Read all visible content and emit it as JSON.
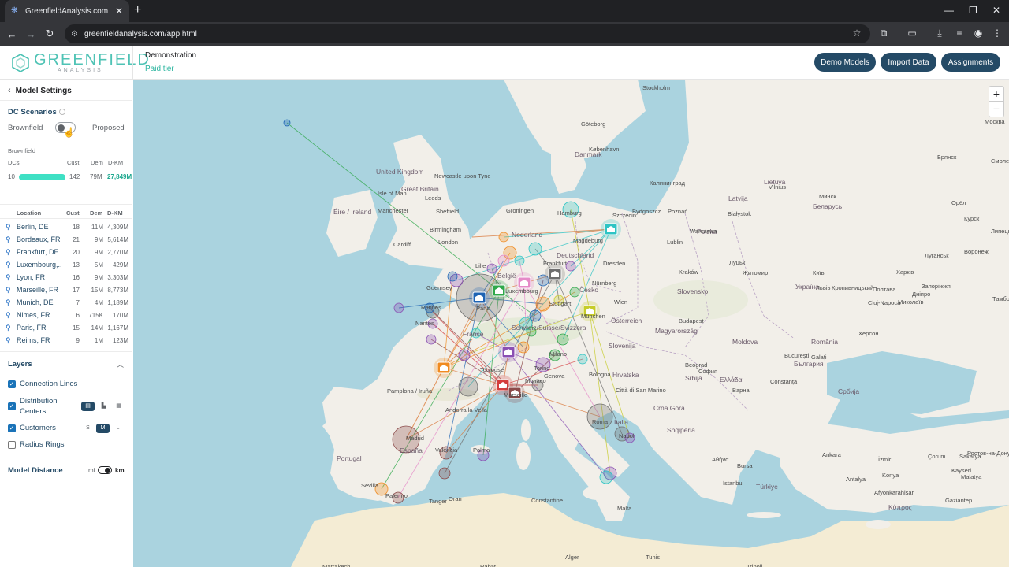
{
  "browser": {
    "tab_title": "GreenfieldAnalysis.com",
    "url": "greenfieldanalysis.com/app.html"
  },
  "header": {
    "logo_main": "GREENFIELD",
    "logo_sub": "ANALYSIS",
    "account_name": "Demonstration",
    "account_tier": "Paid tier",
    "buttons": [
      "Demo Models",
      "Import Data",
      "Assignments"
    ]
  },
  "sidebar": {
    "back_label": "Model Settings",
    "scenarios_title": "DC Scenarios",
    "scenario_left": "Brownfield",
    "scenario_right": "Proposed",
    "summary": {
      "heading": "Brownfield",
      "col_dcs": "DCs",
      "col_cust": "Cust",
      "col_dem": "Dem",
      "col_dkm": "D-KM",
      "dcs": "10",
      "cust": "142",
      "dem": "79M",
      "dkm": "27,849M"
    },
    "table": {
      "headers": [
        "Location",
        "Cust",
        "Dem",
        "D-KM"
      ],
      "rows": [
        {
          "loc": "Berlin, DE",
          "cust": "18",
          "dem": "11M",
          "dkm": "4,309M"
        },
        {
          "loc": "Bordeaux, FR",
          "cust": "21",
          "dem": "9M",
          "dkm": "5,614M"
        },
        {
          "loc": "Frankfurt, DE",
          "cust": "20",
          "dem": "9M",
          "dkm": "2,770M"
        },
        {
          "loc": "Luxembourg,...",
          "cust": "13",
          "dem": "5M",
          "dkm": "429M"
        },
        {
          "loc": "Lyon, FR",
          "cust": "16",
          "dem": "9M",
          "dkm": "3,303M"
        },
        {
          "loc": "Marseille, FR",
          "cust": "17",
          "dem": "15M",
          "dkm": "8,773M"
        },
        {
          "loc": "Munich, DE",
          "cust": "7",
          "dem": "4M",
          "dkm": "1,189M"
        },
        {
          "loc": "Nimes, FR",
          "cust": "6",
          "dem": "715K",
          "dkm": "170M"
        },
        {
          "loc": "Paris, FR",
          "cust": "15",
          "dem": "14M",
          "dkm": "1,167M"
        },
        {
          "loc": "Reims, FR",
          "cust": "9",
          "dem": "1M",
          "dkm": "123M"
        }
      ]
    },
    "layers": {
      "title": "Layers",
      "connection_lines": "Connection Lines",
      "distribution_centers": "Distribution Centers",
      "customers": "Customers",
      "radius_rings": "Radius Rings",
      "sizes": [
        "S",
        "M",
        "L"
      ]
    },
    "model_distance": {
      "title": "Model Distance",
      "mi": "mi",
      "km": "km"
    }
  },
  "map": {
    "zoom_in": "+",
    "zoom_out": "−",
    "labels": [
      {
        "t": "Stockholm",
        "k": "city"
      },
      {
        "t": "Göteborg",
        "k": "city"
      },
      {
        "t": "Danmark",
        "k": "country"
      },
      {
        "t": "København",
        "k": "city"
      },
      {
        "t": "United Kingdom",
        "k": "country"
      },
      {
        "t": "Isle of Man",
        "k": "city"
      },
      {
        "t": "Great Britain",
        "k": "country"
      },
      {
        "t": "Newcastle upon Tyne",
        "k": "city"
      },
      {
        "t": "Leeds",
        "k": "city"
      },
      {
        "t": "Manchester",
        "k": "city"
      },
      {
        "t": "Sheffield",
        "k": "city"
      },
      {
        "t": "Birmingham",
        "k": "city"
      },
      {
        "t": "Éire / Ireland",
        "k": "country"
      },
      {
        "t": "Cardiff",
        "k": "city"
      },
      {
        "t": "London",
        "k": "city"
      },
      {
        "t": "Groningen",
        "k": "city"
      },
      {
        "t": "Hamburg",
        "k": "city"
      },
      {
        "t": "Szczecin",
        "k": "city"
      },
      {
        "t": "Nederland",
        "k": "country"
      },
      {
        "t": "Magdeburg",
        "k": "city"
      },
      {
        "t": "Deutschland",
        "k": "country"
      },
      {
        "t": "Polska",
        "k": "country"
      },
      {
        "t": "Warszawa",
        "k": "city"
      },
      {
        "t": "Lille",
        "k": "city"
      },
      {
        "t": "België",
        "k": "country"
      },
      {
        "t": "Frankfurt",
        "k": "city"
      },
      {
        "t": "Dresden",
        "k": "city"
      },
      {
        "t": "Kraków",
        "k": "city"
      },
      {
        "t": "Luxembourg",
        "k": "city"
      },
      {
        "t": "Nürnberg",
        "k": "city"
      },
      {
        "t": "Guernsey",
        "k": "city"
      },
      {
        "t": "Stuttgart",
        "k": "city"
      },
      {
        "t": "Česko",
        "k": "country"
      },
      {
        "t": "Slovensko",
        "k": "country"
      },
      {
        "t": "Rennes",
        "k": "city"
      },
      {
        "t": "Paris",
        "k": "city"
      },
      {
        "t": "München",
        "k": "city"
      },
      {
        "t": "Wien",
        "k": "city"
      },
      {
        "t": "Österreich",
        "k": "country"
      },
      {
        "t": "Nantes",
        "k": "city"
      },
      {
        "t": "France",
        "k": "country"
      },
      {
        "t": "Schweiz/Suisse/Svizzera",
        "k": "country"
      },
      {
        "t": "Magyarország",
        "k": "country"
      },
      {
        "t": "Budapest",
        "k": "city"
      },
      {
        "t": "Slovenija",
        "k": "country"
      },
      {
        "t": "Milano",
        "k": "city"
      },
      {
        "t": "Torino",
        "k": "city"
      },
      {
        "t": "Hrvatska",
        "k": "country"
      },
      {
        "t": "Genova",
        "k": "city"
      },
      {
        "t": "Bologna",
        "k": "city"
      },
      {
        "t": "Beograd",
        "k": "city"
      },
      {
        "t": "Srbija",
        "k": "country"
      },
      {
        "t": "Monaco",
        "k": "city"
      },
      {
        "t": "Città di San Marino",
        "k": "city"
      },
      {
        "t": "Toulouse",
        "k": "city"
      },
      {
        "t": "Marseille",
        "k": "city"
      },
      {
        "t": "Pamplona / Iruña",
        "k": "city"
      },
      {
        "t": "Andorra la Vella",
        "k": "city"
      },
      {
        "t": "Italia",
        "k": "country"
      },
      {
        "t": "Roma",
        "k": "city"
      },
      {
        "t": "Crna Gora",
        "k": "country"
      },
      {
        "t": "Shqipëria",
        "k": "country"
      },
      {
        "t": "Madrid",
        "k": "city"
      },
      {
        "t": "España",
        "k": "country"
      },
      {
        "t": "València",
        "k": "city"
      },
      {
        "t": "Palma",
        "k": "city"
      },
      {
        "t": "Napoli",
        "k": "city"
      },
      {
        "t": "Portugal",
        "k": "country"
      },
      {
        "t": "Sevilla",
        "k": "city"
      },
      {
        "t": "Palermo",
        "k": "city"
      },
      {
        "t": "Tanger",
        "k": "city"
      },
      {
        "t": "Oran",
        "k": "city"
      },
      {
        "t": "Constantine",
        "k": "city"
      },
      {
        "t": "Malta",
        "k": "city"
      },
      {
        "t": "Marrakech",
        "k": "city"
      },
      {
        "t": "Latvija",
        "k": "country"
      },
      {
        "t": "Lietuva",
        "k": "country"
      },
      {
        "t": "Vilnius",
        "k": "city"
      },
      {
        "t": "Калининград",
        "k": "city"
      },
      {
        "t": "Bydgoszcz",
        "k": "city"
      },
      {
        "t": "Poznań",
        "k": "city"
      },
      {
        "t": "Białystok",
        "k": "city"
      },
      {
        "t": "Беларусь",
        "k": "country"
      },
      {
        "t": "Минск",
        "k": "city"
      },
      {
        "t": "Lublin",
        "k": "city"
      },
      {
        "t": "Луцьк",
        "k": "city"
      },
      {
        "t": "Житомир",
        "k": "city"
      },
      {
        "t": "Київ",
        "k": "city"
      },
      {
        "t": "Україна",
        "k": "country"
      },
      {
        "t": "Львів",
        "k": "city"
      },
      {
        "t": "Полтава",
        "k": "city"
      },
      {
        "t": "Харків",
        "k": "city"
      },
      {
        "t": "Дніпро",
        "k": "city"
      },
      {
        "t": "Кропивницький",
        "k": "city"
      },
      {
        "t": "Запоріжжя",
        "k": "city"
      },
      {
        "t": "Миколаїв",
        "k": "city"
      },
      {
        "t": "Cluj-Napoca",
        "k": "city"
      },
      {
        "t": "Moldova",
        "k": "country"
      },
      {
        "t": "România",
        "k": "country"
      },
      {
        "t": "București",
        "k": "city"
      },
      {
        "t": "Constanța",
        "k": "city"
      },
      {
        "t": "Херсон",
        "k": "city"
      },
      {
        "t": "Galați",
        "k": "city"
      },
      {
        "t": "България",
        "k": "country"
      },
      {
        "t": "София",
        "k": "city"
      },
      {
        "t": "Варна",
        "k": "city"
      },
      {
        "t": "Србија",
        "k": "country"
      },
      {
        "t": "Ελλάδα",
        "k": "country"
      },
      {
        "t": "Αθήνα",
        "k": "city"
      },
      {
        "t": "İstanbul",
        "k": "city"
      },
      {
        "t": "Ankara",
        "k": "city"
      },
      {
        "t": "İzmir",
        "k": "city"
      },
      {
        "t": "Türkiye",
        "k": "country"
      },
      {
        "t": "Konya",
        "k": "city"
      },
      {
        "t": "Afyonkarahisar",
        "k": "city"
      },
      {
        "t": "Antalya",
        "k": "city"
      },
      {
        "t": "Κύπρος",
        "k": "country"
      },
      {
        "t": "Gaziantep",
        "k": "city"
      },
      {
        "t": "Ростов-на-Дону",
        "k": "city"
      },
      {
        "t": "Москва",
        "k": "city"
      },
      {
        "t": "Орёл",
        "k": "city"
      },
      {
        "t": "Курск",
        "k": "city"
      },
      {
        "t": "Брянск",
        "k": "city"
      },
      {
        "t": "Смоленск",
        "k": "city"
      },
      {
        "t": "Липецк",
        "k": "city"
      },
      {
        "t": "Воронеж",
        "k": "city"
      },
      {
        "t": "Луганськ",
        "k": "city"
      },
      {
        "t": "Тамбов",
        "k": "city"
      },
      {
        "t": "Bursa",
        "k": "city"
      },
      {
        "t": "Kayseri",
        "k": "city"
      },
      {
        "t": "Sakarya",
        "k": "city"
      },
      {
        "t": "Çorum",
        "k": "city"
      },
      {
        "t": "Malatya",
        "k": "city"
      },
      {
        "t": "Tripoli",
        "k": "city"
      },
      {
        "t": "Tunis",
        "k": "city"
      },
      {
        "t": "Alger",
        "k": "city"
      },
      {
        "t": "Rabat",
        "k": "city"
      }
    ]
  },
  "colors": {
    "accent": "#244a66",
    "teal": "#3ee0c4",
    "water": "#aad3df",
    "land": "#f2efe9"
  }
}
